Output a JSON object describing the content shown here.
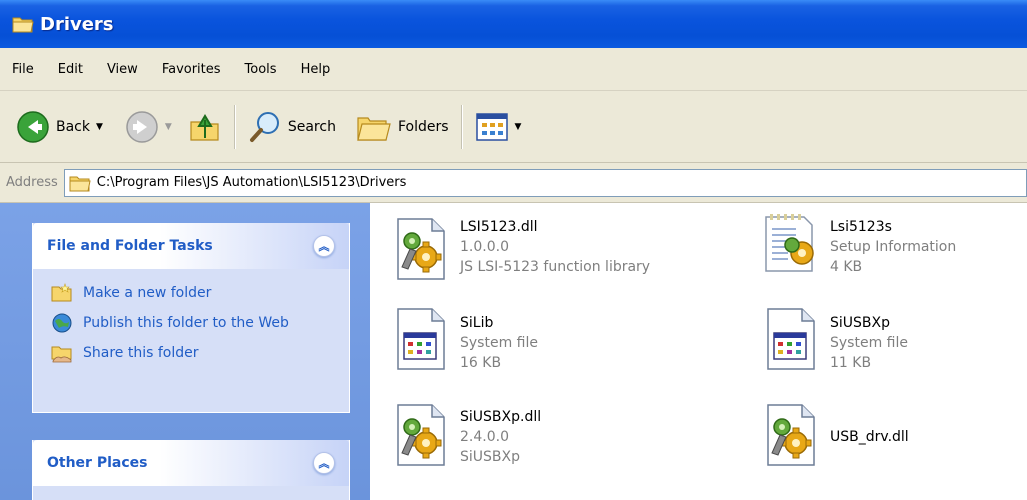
{
  "window": {
    "title": "Drivers"
  },
  "menu": [
    "File",
    "Edit",
    "View",
    "Favorites",
    "Tools",
    "Help"
  ],
  "toolbar": {
    "back_label": "Back",
    "search_label": "Search",
    "folders_label": "Folders"
  },
  "address": {
    "label": "Address",
    "path": "C:\\Program Files\\JS Automation\\LSI5123\\Drivers"
  },
  "tasks_panel": {
    "title": "File and Folder Tasks",
    "items": [
      "Make a new folder",
      "Publish this folder to the Web",
      "Share this folder"
    ]
  },
  "other_places": {
    "title": "Other Places"
  },
  "files": [
    {
      "name": "LSI5123.dll",
      "line2": "1.0.0.0",
      "line3": "JS LSI-5123 function library",
      "icon": "dll-icon"
    },
    {
      "name": "Lsi5123s",
      "line2": "Setup Information",
      "line3": "4 KB",
      "icon": "setup-info-icon"
    },
    {
      "name": "SiLib",
      "line2": "System file",
      "line3": "16 KB",
      "icon": "system-file-icon"
    },
    {
      "name": "SiUSBXp",
      "line2": "System file",
      "line3": "11 KB",
      "icon": "system-file-icon"
    },
    {
      "name": "SiUSBXp.dll",
      "line2": "2.4.0.0",
      "line3": "SiUSBXp",
      "icon": "dll-icon"
    },
    {
      "name": "USB_drv.dll",
      "icon": "dll-icon"
    }
  ],
  "colors": {
    "title_bar": "#0650d6",
    "task_link": "#215dc6",
    "pane_bg": "#6b94dc",
    "chrome": "#ece9d8"
  }
}
